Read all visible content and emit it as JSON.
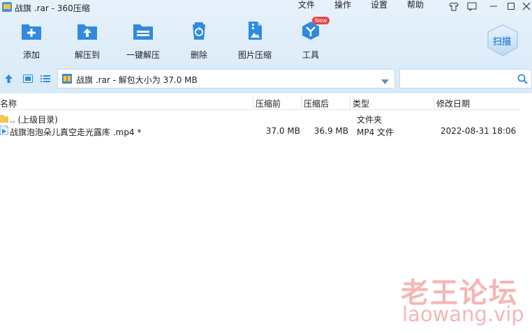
{
  "window": {
    "title": "战旗 .rar - 360压缩"
  },
  "menu": [
    "文件",
    "操作",
    "设置",
    "帮助"
  ],
  "toolbar": [
    {
      "label": "添加",
      "icon": "add-folder-icon"
    },
    {
      "label": "解压到",
      "icon": "extract-to-icon"
    },
    {
      "label": "一键解压",
      "icon": "one-click-extract-icon"
    },
    {
      "label": "删除",
      "icon": "recycle-bin-icon"
    },
    {
      "label": "图片压缩",
      "icon": "image-compress-icon"
    },
    {
      "label": "工具",
      "icon": "tools-icon"
    }
  ],
  "tools_badge": "New",
  "scan_label": "扫描",
  "path_bar": {
    "text": "战旗 .rar - 解包大小为 37.0 MB"
  },
  "columns": {
    "name": "名称",
    "before": "压缩前",
    "after": "压缩后",
    "type": "类型",
    "date": "修改日期"
  },
  "rows": [
    {
      "name": ".. (上级目录)",
      "before": "",
      "after": "",
      "type": "文件夹",
      "date": ""
    },
    {
      "name": "战旗泡泡朵儿真空走光露庝 .mp4 *",
      "before": "37.0 MB",
      "after": "36.9 MB",
      "type": "MP4 文件",
      "date": "2022-08-31 18:06"
    }
  ],
  "watermark": {
    "cn": "老王论坛",
    "en": "laowang.vip"
  },
  "colors": {
    "accent": "#2f8ae0",
    "watermark": "#f4b6b6"
  }
}
